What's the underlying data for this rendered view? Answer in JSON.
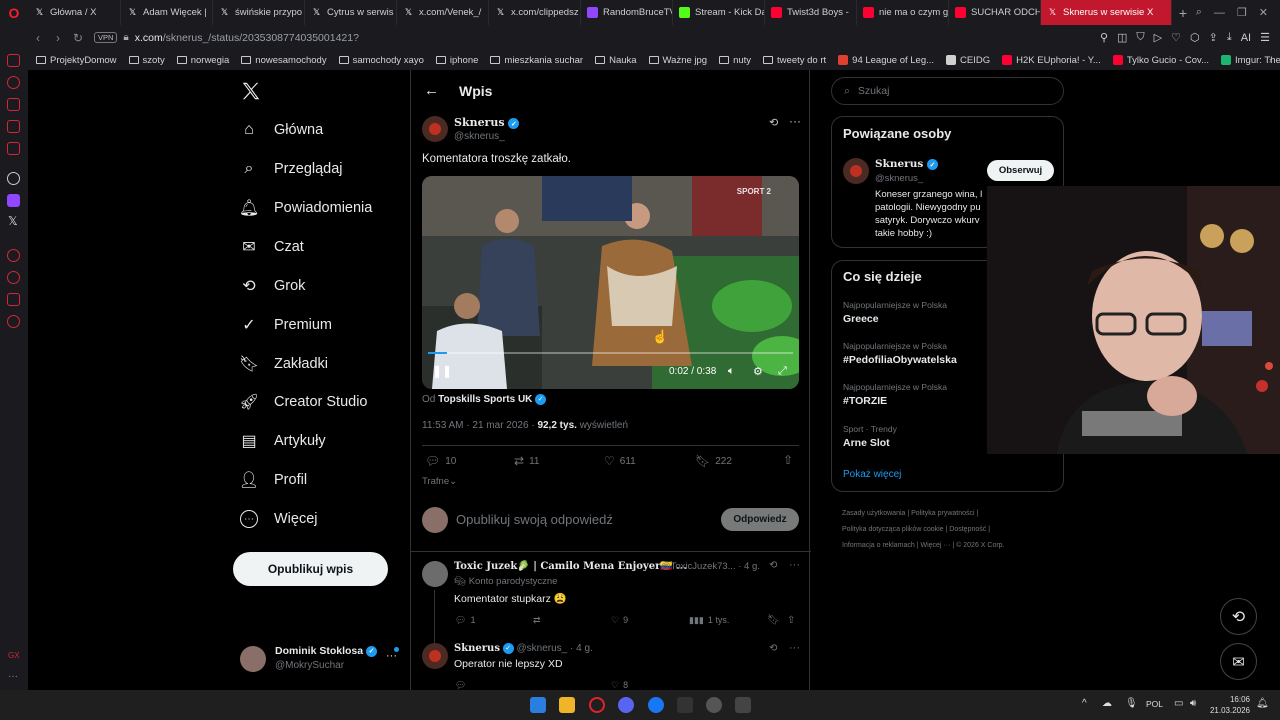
{
  "browser": {
    "tabs": [
      {
        "title": "Główna / X",
        "fav": "x-logo",
        "color": "#ffffff",
        "active": false
      },
      {
        "title": "Adam Więcek | ",
        "fav": "x-logo",
        "color": "#ffffff",
        "active": false
      },
      {
        "title": "świńskie przypo",
        "fav": "x-logo",
        "color": "#ffffff",
        "active": false
      },
      {
        "title": "Cytrus w serwis",
        "fav": "x-logo",
        "color": "#ffffff",
        "active": false
      },
      {
        "title": "x.com/Venek_/",
        "fav": "x-logo",
        "color": "#ffffff",
        "active": false
      },
      {
        "title": "x.com/clippedsz",
        "fav": "x-logo",
        "color": "#ffffff",
        "active": false
      },
      {
        "title": "RandomBruceTV",
        "fav": "twitch-icon",
        "color": "#9146ff",
        "active": false
      },
      {
        "title": "Stream - Kick Da",
        "fav": "kick-icon",
        "color": "#53fc18",
        "active": false
      },
      {
        "title": "Twist3d Boys - ",
        "fav": "youtube-icon",
        "color": "#ff0033",
        "active": false
      },
      {
        "title": "nie ma o czym g",
        "fav": "youtube-icon",
        "color": "#ff0033",
        "active": false
      },
      {
        "title": "SUCHAR ODCH",
        "fav": "youtube-icon",
        "color": "#ff0033",
        "active": false
      },
      {
        "title": "Sknerus w serwisie X",
        "fav": "x-logo",
        "color": "#ffffff",
        "active": true
      }
    ],
    "new_tab": "+",
    "url_domain": "x.com",
    "url_path": "/sknerus_/status/2035308774035001421?",
    "vpn_label": "VPN",
    "bookmarks": [
      {
        "label": "ProjektyDomow",
        "type": "folder"
      },
      {
        "label": "szoty",
        "type": "folder"
      },
      {
        "label": "norwegia",
        "type": "folder"
      },
      {
        "label": "nowesamochody",
        "type": "folder"
      },
      {
        "label": "samochody xayo",
        "type": "folder"
      },
      {
        "label": "iphone",
        "type": "folder"
      },
      {
        "label": "mieszkania suchar",
        "type": "folder"
      },
      {
        "label": "Nauka",
        "type": "folder"
      },
      {
        "label": "Ważne jpg",
        "type": "folder"
      },
      {
        "label": "nuty",
        "type": "folder"
      },
      {
        "label": "tweety do rt",
        "type": "folder"
      },
      {
        "label": "94 League of Leg...",
        "type": "site",
        "color": "#e0402f"
      },
      {
        "label": "CEIDG",
        "type": "site",
        "color": "#d0d0d0"
      },
      {
        "label": "H2K EUphoria! - Y...",
        "type": "site",
        "color": "#ff0033"
      },
      {
        "label": "Tylko Gucio - Cov...",
        "type": "site",
        "color": "#ff0033"
      },
      {
        "label": "Imgur: The most a...",
        "type": "site",
        "color": "#1bb76e"
      }
    ]
  },
  "nav": {
    "items": [
      {
        "label": "Główna",
        "icon": "home-icon"
      },
      {
        "label": "Przeglądaj",
        "icon": "search-icon"
      },
      {
        "label": "Powiadomienia",
        "icon": "bell-icon"
      },
      {
        "label": "Czat",
        "icon": "mail-icon"
      },
      {
        "label": "Grok",
        "icon": "grok-icon"
      },
      {
        "label": "Premium",
        "icon": "premium-icon"
      },
      {
        "label": "Zakładki",
        "icon": "bookmark-icon"
      },
      {
        "label": "Creator Studio",
        "icon": "rocket-icon"
      },
      {
        "label": "Artykuły",
        "icon": "article-icon"
      },
      {
        "label": "Profil",
        "icon": "person-icon"
      },
      {
        "label": "Więcej",
        "icon": "more-icon"
      }
    ],
    "post_button": "Opublikuj wpis",
    "account": {
      "name": "Dominik Stoklosa",
      "handle": "@MokrySuchar"
    }
  },
  "main": {
    "header_title": "Wpis",
    "tweet": {
      "author_name": "Sknerus",
      "author_handle": "@sknerus_",
      "text": "Komentatora troszkę zatkało.",
      "video_time": "0:02 / 0:38",
      "video_progress": 0.052,
      "watermark": "SPORT 2",
      "source_prefix": "Od",
      "source_name": "Topskills Sports UK",
      "time": "11:53 AM · 21 mar 2026 ·",
      "views_count": "92,2 tys.",
      "views_label": "wyświetleń",
      "replies": "10",
      "retweets": "11",
      "likes": "611",
      "bookmarks": "222",
      "sort_label": "Trafne"
    },
    "reply_box": {
      "placeholder": "Opublikuj swoją odpowiedź",
      "button": "Odpowiedz"
    },
    "replies": [
      {
        "name": "Toxic Juzek🥬 | Camilo Mena Enjoyer🇨🇴 ...",
        "handle": "@ToxicJuzek73...",
        "age": "· 4 g.",
        "badge": "Konto parodystyczne",
        "text": "Komentator stupkarz 😩",
        "stats": {
          "replies": "1",
          "retweets": "",
          "likes": "9",
          "views": "1 tys."
        }
      },
      {
        "name": "Sknerus",
        "handle": "@sknerus_",
        "age": "· 4 g.",
        "text": "Operator nie lepszy XD",
        "stats": {
          "replies": "",
          "retweets": "",
          "likes": "8",
          "views": ""
        }
      }
    ]
  },
  "sidebar": {
    "search_placeholder": "Szukaj",
    "related_title": "Powiązane osoby",
    "related": {
      "name": "Sknerus",
      "handle": "@sknerus_",
      "follow": "Obserwuj",
      "bio_lines": [
        "Koneser grzanego wina, l",
        "patologii. Niewygodny pu",
        "satyryk. Dorywczo wkurv",
        "takie hobby :)"
      ]
    },
    "trends_title": "Co się dzieje",
    "trends": [
      {
        "context": "Najpopularniejsze w Polska",
        "title": "Greece"
      },
      {
        "context": "Najpopularniejsze w Polska",
        "title": "#PedofiliaObywatelska"
      },
      {
        "context": "Najpopularniejsze w Polska",
        "title": "#TORZIE"
      },
      {
        "context": "Sport · Trendy",
        "title": "Arne Slot"
      }
    ],
    "show_more": "Pokaż więcej",
    "footer": [
      "Zasady użytkowania",
      "Polityka prywatności",
      "Polityka dotycząca plików cookie",
      "Dostępność",
      "Informacja o reklamach",
      "Więcej ···",
      "© 2026 X Corp."
    ]
  },
  "taskbar": {
    "language": "POL",
    "time": "16:06",
    "date": "21.03.2026"
  }
}
